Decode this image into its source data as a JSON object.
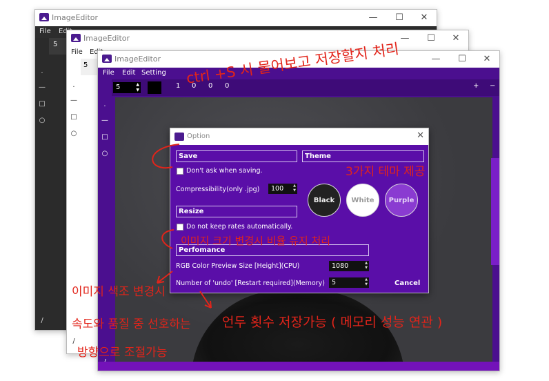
{
  "windows": {
    "dark": {
      "title": "ImageEditor",
      "menu": [
        "File",
        "Edit"
      ],
      "brush_size": "5",
      "controls": {
        "minimize": "—",
        "maximize": "☐",
        "close": "✕"
      }
    },
    "white": {
      "title": "ImageEditor",
      "menu": [
        "File",
        "Edit"
      ],
      "brush_size": "5",
      "controls": {
        "minimize": "—",
        "maximize": "☐",
        "close": "✕"
      }
    },
    "purple": {
      "title": "ImageEditor",
      "menu": [
        "File",
        "Edit",
        "Setting"
      ],
      "brush_size": "5",
      "toolbar_values": [
        "1",
        "0",
        "0",
        "0"
      ],
      "toolbar_right": [
        "+",
        "−"
      ],
      "controls": {
        "minimize": "—",
        "maximize": "☐",
        "close": "✕"
      }
    }
  },
  "tools": [
    "·",
    "—",
    "□",
    "○",
    "/"
  ],
  "dialog": {
    "title": "Option",
    "close": "✕",
    "save_section": "Save",
    "dont_ask_label": "Don't ask when saving.",
    "compressibility_label": "Compressibility(only .jpg)",
    "compressibility_value": "100",
    "theme_section": "Theme",
    "themes": [
      "Black",
      "White",
      "Purple"
    ],
    "resize_section": "Resize",
    "keep_rates_label": "Do not keep rates automatically.",
    "performance_section": "Perfomance",
    "rgb_preview_label": "RGB Color Preview Size [Height](CPU)",
    "rgb_preview_value": "1080",
    "undo_label": "Number of 'undo' [Restart required](Memory)",
    "undo_value": "5",
    "cancel": "Cancel"
  },
  "annotations": {
    "ctrl_s": "ctrl +S 시 물어보고 저장할지 처리",
    "themes": "3가지 테마 제공",
    "resize": "이미지 크기 변경시 비율 유지 처리",
    "rgb_line1": "이미지 색조 변경시",
    "rgb_line2": "속도와 품질 중 선호하는",
    "rgb_line3": "방향으로 조절가능",
    "undo": "언두 횟수 저장가능 ( 메모리 성능 연관 )",
    "circle_six": "6"
  },
  "colors": {
    "purple": "#4b0f8f",
    "dialog": "#5a0ea8",
    "annotation": "#e2241a",
    "theme_purple": "#8a3bd1"
  }
}
